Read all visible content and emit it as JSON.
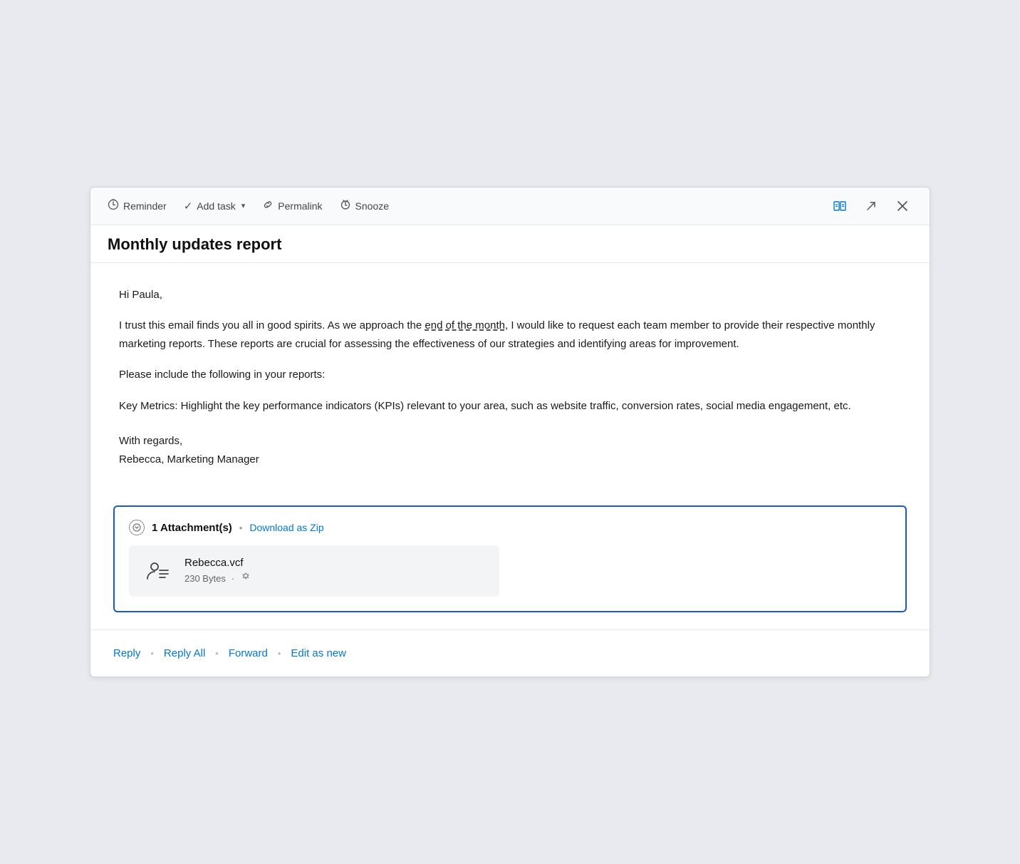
{
  "toolbar": {
    "reminder_label": "Reminder",
    "add_task_label": "Add task",
    "permalink_label": "Permalink",
    "snooze_label": "Snooze"
  },
  "email": {
    "subject": "Monthly updates report",
    "greeting": "Hi Paula,",
    "body_paragraph_1": "I trust this email finds you all in good spirits. As we approach the end of the month, I would like to request each team member to provide their respective monthly marketing reports. These reports are crucial for assessing the effectiveness of our strategies and identifying areas for improvement.",
    "body_paragraph_2": "Please include the following in your reports:",
    "body_paragraph_3": "Key Metrics: Highlight the key performance indicators (KPIs) relevant to your area, such as website traffic, conversion rates, social media engagement, etc.",
    "signature_line1": "With regards,",
    "signature_line2": "Rebecca, Marketing Manager",
    "end_of_month_underline": "end of the month"
  },
  "attachment": {
    "count_label": "1 Attachment(s)",
    "download_label": "Download as Zip",
    "file_name": "Rebecca.vcf",
    "file_size": "230 Bytes"
  },
  "actions": {
    "reply_label": "Reply",
    "reply_all_label": "Reply All",
    "forward_label": "Forward",
    "edit_as_new_label": "Edit as new"
  }
}
